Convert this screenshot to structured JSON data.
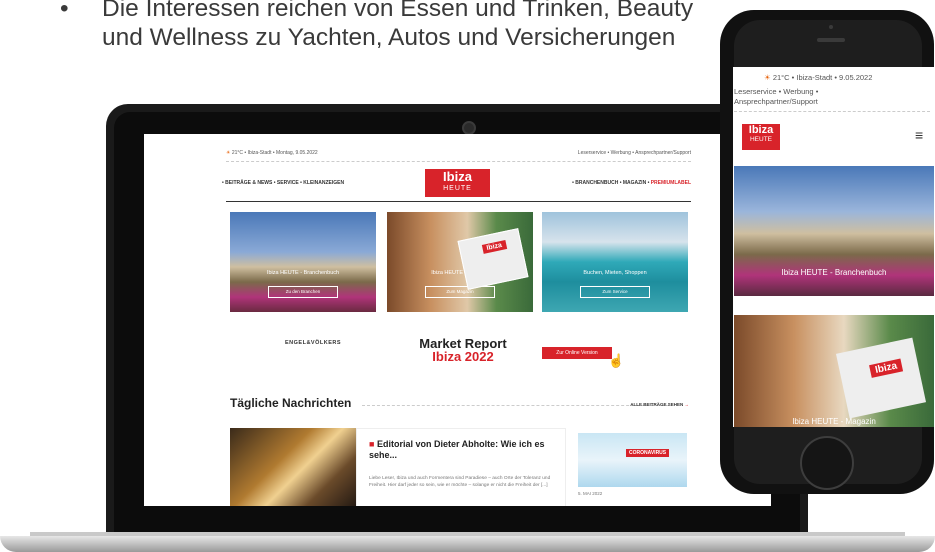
{
  "slide": {
    "bullet": "•",
    "text": "Die Interessen reichen von Essen und Trinken, Beauty und Wellness zu Yachten, Autos und Versicherungen"
  },
  "laptop_site": {
    "weather": "21°C",
    "location_date": "Ibiza-Stadt • Montag, 9.05.2022",
    "top_links": "Leserservice • Werbung • Ansprechpartner/Support",
    "nav_left": "• BEITRÄGE & NEWS   • SERVICE   • KLEINANZEIGEN",
    "nav_right_plain": "• BRANCHENBUCH   • MAGAZIN   • ",
    "nav_right_red": "PREMIUMLABEL",
    "logo_line1": "Ibiza",
    "logo_line2": "HEUTE",
    "cards": [
      {
        "caption": "Ibiza HEUTE - Branchenbuch",
        "button": "Zu den Branchen"
      },
      {
        "caption": "Ibiza HEUTE - Magazin",
        "button": "Zum Magazin"
      },
      {
        "caption": "Buchen, Mieten, Shoppen",
        "button": "Zum Service"
      }
    ],
    "magazine_tag": "Ibiza",
    "ev_logo": "ENGEL&VÖLKERS",
    "market_report_1": "Market Report",
    "market_report_2": "Ibiza 2022",
    "online_button": "Zur Online Version",
    "section_title": "Tägliche Nachrichten",
    "all_posts": "ALLE BEITRÄGE SEHEN",
    "news_title": "Editorial von Dieter Abholte: Wie ich es sehe...",
    "news_body": "Liebe Leser, Ibiza und auch Formentera sind Paradiese – auch Orte der Toleranz und Freiheit. Hier darf jeder so sein, wie er möchte – solange er nicht die Freiheit der [...]",
    "side_tag": "CORONAVIRUS",
    "side_date": "5. MAI 2022"
  },
  "phone_site": {
    "weather": "21°C",
    "location_date": "Ibiza-Stadt • 9.05.2022",
    "links_1": "Leserservice • Werbung •",
    "links_2": "Ansprechpartner/Support",
    "logo_line1": "Ibiza",
    "logo_line2": "HEUTE",
    "card1_caption": "Ibiza HEUTE - Branchenbuch",
    "card2_caption": "Ibiza HEUTE - Magazin",
    "magazine_tag": "Ibiza"
  }
}
